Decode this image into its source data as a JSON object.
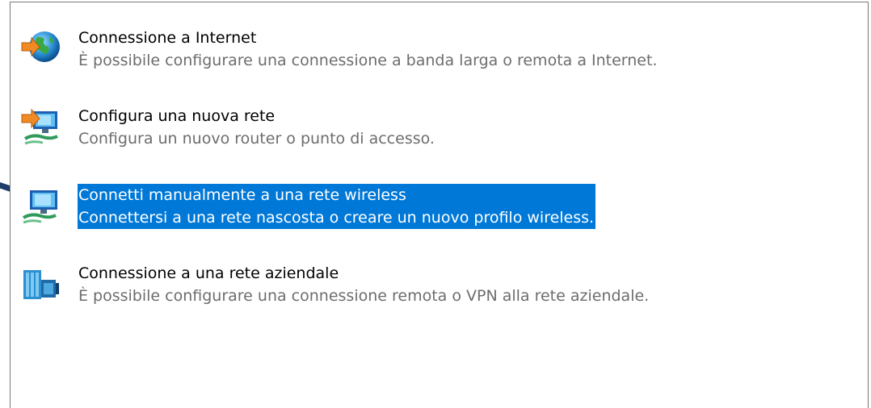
{
  "options": [
    {
      "title": "Connessione a Internet",
      "description": "È possibile configurare una connessione a banda larga o remota a Internet.",
      "icon": "globe-connection-icon",
      "selected": false
    },
    {
      "title": "Configura una nuova rete",
      "description": "Configura un nuovo router o punto di accesso.",
      "icon": "new-network-icon",
      "selected": false
    },
    {
      "title": "Connetti manualmente a una rete wireless",
      "description": "Connettersi a una rete nascosta o creare un nuovo profilo wireless.",
      "icon": "wireless-network-icon",
      "selected": true
    },
    {
      "title": "Connessione a una rete aziendale",
      "description": "È possibile configurare una connessione remota o VPN alla rete aziendale.",
      "icon": "workplace-network-icon",
      "selected": false
    }
  ],
  "colors": {
    "selection": "#0078d7",
    "description_text": "#6d6d6d",
    "pointer_arrow": "#1f3d6b"
  }
}
